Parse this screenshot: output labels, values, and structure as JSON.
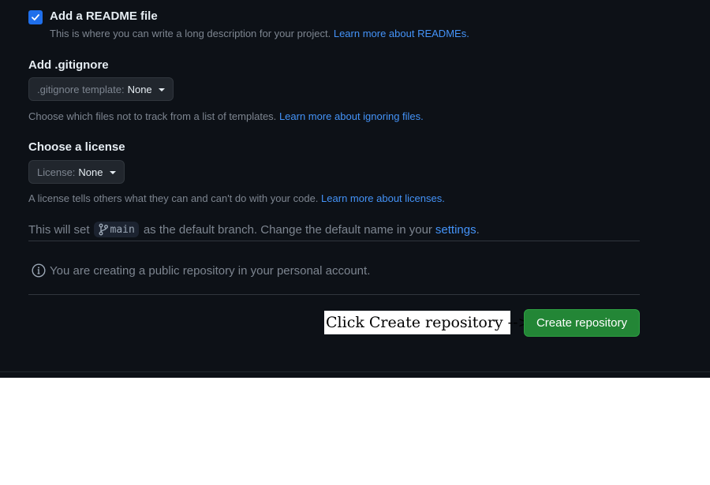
{
  "readme": {
    "checked": true,
    "label": "Add a README file",
    "description": "This is where you can write a long description for your project.",
    "link": "Learn more about READMEs."
  },
  "gitignore": {
    "title": "Add .gitignore",
    "dropdown_key": ".gitignore template:",
    "dropdown_value": "None",
    "helper": "Choose which files not to track from a list of templates.",
    "link": "Learn more about ignoring files."
  },
  "license": {
    "title": "Choose a license",
    "dropdown_key": "License:",
    "dropdown_value": "None",
    "helper": "A license tells others what they can and can't do with your code.",
    "link": "Learn more about licenses."
  },
  "branch": {
    "prefix": "This will set",
    "name": "main",
    "suffix": "as the default branch. Change the default name in your",
    "settings_link": "settings",
    "end": "."
  },
  "info": {
    "text": "You are creating a public repository in your personal account."
  },
  "annotation": "Click Create repository -->",
  "create_button": "Create repository",
  "colors": {
    "background": "#0d1117",
    "link": "#4493f8",
    "primary_button": "#238636",
    "checkbox": "#1f6feb"
  },
  "icons": {
    "checkbox": "check-icon",
    "branch": "git-branch-icon",
    "info": "info-icon",
    "caret": "caret-down-icon"
  }
}
